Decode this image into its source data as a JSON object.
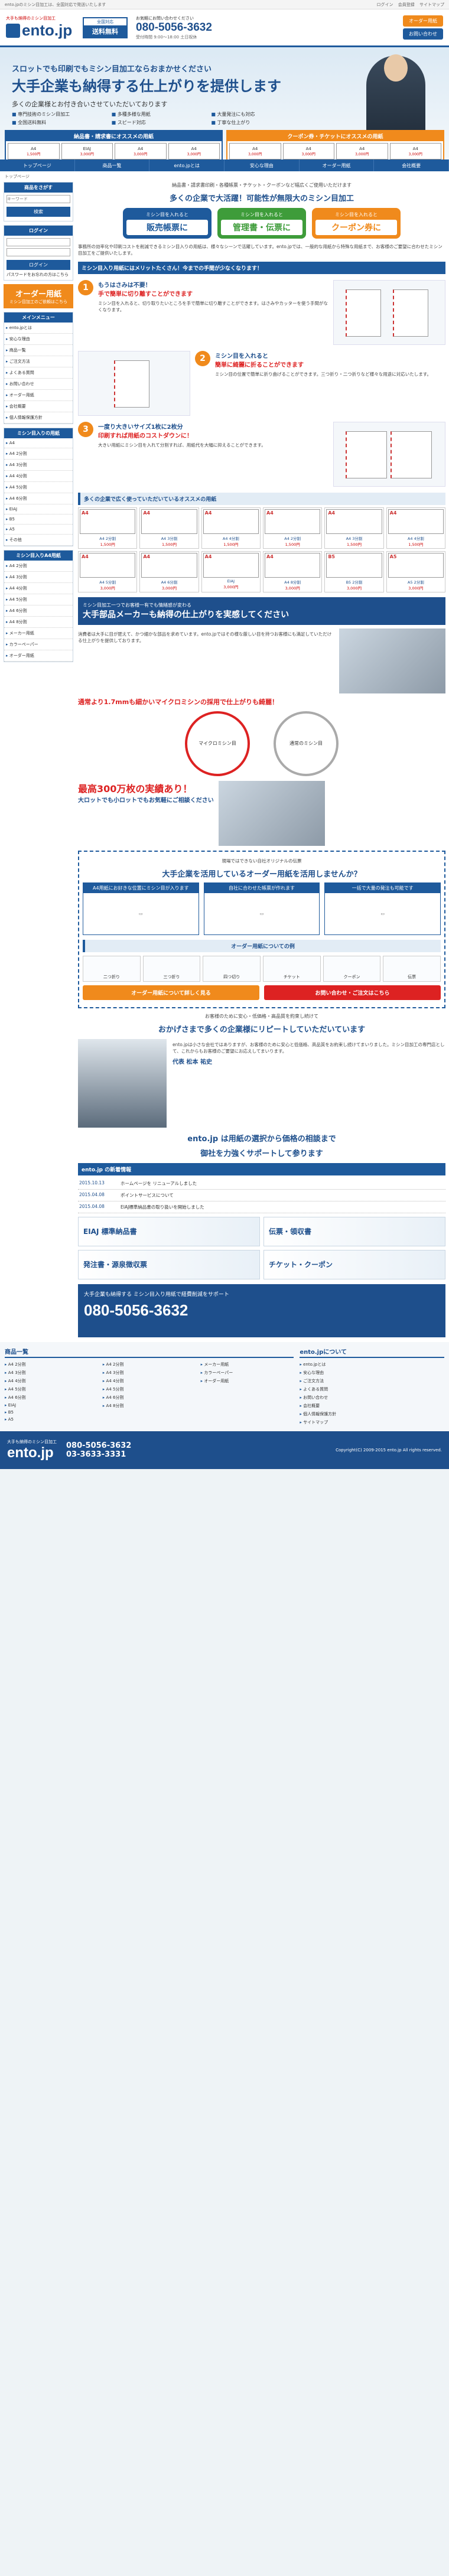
{
  "topbar": {
    "notice": "ento.jpのミシン目加工は、全国対応で発送いたします",
    "links": [
      "ログイン",
      "会員登録",
      "サイトマップ"
    ]
  },
  "header": {
    "tagline": "大手も納得のミシン目加工",
    "logo": "ento.jp",
    "ship_top": "全国対応",
    "ship_bottom": "送料無料",
    "contact_l1": "お気軽にお問い合わせください",
    "tel": "080-5056-3632",
    "contact_l2": "受付時間 9:00〜18:00 土日祝休",
    "btn_order": "オーダー用紙",
    "btn_contact": "お問い合わせ"
  },
  "hero": {
    "h1": "スロットでも印刷でもミシン目加工ならおまかせください",
    "h2": "大手企業も納得する仕上がりを提供します",
    "h3": "多くの企業様とお付き合いさせていただいております",
    "features": [
      "専門技術のミシン目加工",
      "多種多様な用紙",
      "大量発注にも対応",
      "全国送料無料",
      "スピード対応",
      "丁寧な仕上がり"
    ],
    "card1": "納品書・請求書にオススメの用紙",
    "card2": "クーポン券・チケットにオススメの用紙",
    "minis": [
      {
        "name": "A4",
        "price": "1,500円"
      },
      {
        "name": "EIAJ",
        "price": "3,000円"
      },
      {
        "name": "A4",
        "price": "3,000円"
      },
      {
        "name": "A4",
        "price": "3,000円"
      },
      {
        "name": "A4",
        "price": "3,000円"
      },
      {
        "name": "A4",
        "price": "3,000円"
      },
      {
        "name": "A4",
        "price": "3,000円"
      },
      {
        "name": "A4",
        "price": "3,000円"
      }
    ]
  },
  "nav": [
    "トップページ",
    "商品一覧",
    "ento.jpとは",
    "安心な理由",
    "オーダー用紙",
    "会社概要"
  ],
  "crumb": "トップページ",
  "side": {
    "search_title": "商品をさがす",
    "search_ph": "キーワード",
    "search_btn": "検索",
    "login_title": "ログイン",
    "login_btn": "ログイン",
    "login_note": "パスワードをお忘れの方はこちら",
    "order_t1": "オーダー用紙",
    "order_t2": "ミシン目加工のご依頼はこちら",
    "menu_title": "メインメニュー",
    "menu": [
      "ento.jpとは",
      "安心な理由",
      "商品一覧",
      "ご注文方法",
      "よくある質問",
      "お問い合わせ",
      "オーダー用紙",
      "会社概要",
      "個人情報保護方針"
    ],
    "cat_title": "ミシン目入りの用紙",
    "cats": [
      "A4",
      "A4 2分割",
      "A4 3分割",
      "A4 4分割",
      "A4 5分割",
      "A4 6分割",
      "EIAJ",
      "B5",
      "A5",
      "その他"
    ],
    "cat2_title": "ミシン目入りA4用紙",
    "cats2": [
      "A4 2分割",
      "A4 3分割",
      "A4 4分割",
      "A4 5分割",
      "A4 6分割",
      "A4 8分割",
      "メーカー用紙",
      "カラーペーパー",
      "オーダー用紙"
    ]
  },
  "main": {
    "lead": "納品書・請求書印刷・各種帳票・チケット・クーポンなど幅広くご使用いただけます",
    "title": "多くの企業で大活躍！可能性が無限大のミシン目加工",
    "bub": [
      {
        "t": "ミシン目を入れると",
        "b": "販売帳票に"
      },
      {
        "t": "ミシン目を入れると",
        "b": "管理書・伝票に"
      },
      {
        "t": "ミシン目を入れると",
        "b": "クーポン券に"
      }
    ],
    "intro": "事務所の効率化や印刷コストを削減できるミシン目入りの用紙は、様々なシーンで活躍しています。ento.jpでは、一般的な用紙から特殊な用紙まで、お客様のご要望に合わせたミシン目加工をご提供いたします。",
    "bar1": "ミシン目入り用紙にはメリットたくさん！今までの手間が少なくなります！",
    "points": [
      {
        "n": "1",
        "t": "もうはさみは不要！",
        "s": "手で簡単に切り離すことができます",
        "d": "ミシン目を入れると、切り取りたいところを手で簡単に切り離すことができます。はさみやカッターを使う手間がなくなります。"
      },
      {
        "n": "2",
        "t": "ミシン目を入れると",
        "s": "簡単に綺麗に折ることができます",
        "d": "ミシン目の位置で簡単に折り曲げることができます。三つ折り・二つ折りなど様々な用途に対応いたします。"
      },
      {
        "n": "3",
        "t": "一度り大きいサイズ1枚に2枚分",
        "s": "印刷すれば用紙のコストダウンに！",
        "d": "大きい用紙にミシン目を入れて分割すれば、用紙代を大幅に抑えることができます。"
      }
    ],
    "bar2": "多くの企業で広く使っていただいているオススメの用紙",
    "products": [
      {
        "l": "A4",
        "n": "A4 2分割",
        "p": "1,500円"
      },
      {
        "l": "A4",
        "n": "A4 3分割",
        "p": "1,500円"
      },
      {
        "l": "A4",
        "n": "A4 4分割",
        "p": "1,500円"
      },
      {
        "l": "A4",
        "n": "A4 2分割",
        "p": "1,500円"
      },
      {
        "l": "A4",
        "n": "A4 3分割",
        "p": "1,500円"
      },
      {
        "l": "A4",
        "n": "A4 4分割",
        "p": "1,500円"
      },
      {
        "l": "A4",
        "n": "A4 5分割",
        "p": "3,000円"
      },
      {
        "l": "A4",
        "n": "A4 6分割",
        "p": "3,000円"
      },
      {
        "l": "A4",
        "n": "EIAJ",
        "p": "3,000円"
      },
      {
        "l": "A4",
        "n": "A4 8分割",
        "p": "3,000円"
      },
      {
        "l": "B5",
        "n": "B5 2分割",
        "p": "3,000円"
      },
      {
        "l": "A5",
        "n": "A5 2分割",
        "p": "3,000円"
      }
    ],
    "maker1": "ミシン目加工一つでお客様一有でも情緒感が変わる",
    "maker2": "大手部品メーカーも納得の仕上がりを実感してください",
    "maker_p": "消費者は大手に目が肥えて、かつ細かな部品を求めています。ento.jpではその様な厳しい目を持つお客様にも満足していただける仕上がりを提供しております。",
    "hl1": "通常より1.7mmも細かいマイクロミシンの採用で仕上がりも綺麗！",
    "circ1": "マイクロミシン目",
    "circ2": "通常のミシン目",
    "big300": "最高300万枚の実績あり！",
    "big300_sub": "大ロットでも小ロットでもお気軽にご相談ください",
    "q1": "現場ではできない自社オリジナルの伝票",
    "q2": "大手企業を活用しているオーダー用紙を活用しませんか？",
    "flow": [
      "A4用紙にお好きな位置にミシン目が入ります",
      "自社に合わせた帳票が作れます",
      "一括で大量の発注も可能です"
    ],
    "flow_title": "オーダー用紙についての例",
    "tabs": [
      "二つ折り",
      "三つ折り",
      "四つ切り",
      "チケット",
      "クーポン",
      "伝票"
    ],
    "cta1": "オーダー用紙について詳しく見る",
    "cta2": "お問い合わせ・ご注文はこちら",
    "person_title": "お客様のために安心・低価格・高品質を約束し続けて",
    "person_title2": "おかげさまで多くの企業様にリピートしていただいています",
    "person_name": "代表 松本 祐史",
    "person_p": "ento.jpは小さな会社ではありますが、お客様のために安心と低価格、高品質をお約束し続けてまいりました。ミシン目加工の専門店として、これからもお客様のご要望にお応えしてまいります。",
    "ento_p1": "ento.jp は用紙の選択から価格の相談まで",
    "ento_p2": "御社を力強くサポートして参ります",
    "news_title": "ento.jp の新着情報",
    "news": [
      {
        "d": "2015.10.13",
        "t": "ホームページを リニューアルしました"
      },
      {
        "d": "2015.04.08",
        "t": "ポイントサービスについて"
      },
      {
        "d": "2015.04.08",
        "t": "EIAJ標準納品書の取り扱いを開始しました"
      }
    ],
    "promo": [
      "EIAJ 標準納品書",
      "伝票・領収書",
      "発注書・源泉徴収票",
      "チケット・クーポン"
    ],
    "big_cta_t1": "大手企業も納得する ミシン目入り用紙で経費削減をサポート",
    "big_cta_tel": "080-5056-3632"
  },
  "fnav": {
    "h1": "商品一覧",
    "h2": "ento.jpについて",
    "c1": [
      "A4 2分割",
      "A4 3分割",
      "A4 4分割",
      "A4 5分割",
      "A4 6分割",
      "EIAJ",
      "B5",
      "A5"
    ],
    "c2": [
      "A4 2分割",
      "A4 3分割",
      "A4 4分割",
      "A4 5分割",
      "A4 6分割",
      "A4 8分割"
    ],
    "c3": [
      "メーカー用紙",
      "カラーペーパー",
      "オーダー用紙"
    ],
    "c4": [
      "ento.jpとは",
      "安心な理由",
      "ご注文方法",
      "よくある質問",
      "お問い合わせ",
      "会社概要",
      "個人情報保護方針",
      "サイトマップ"
    ]
  },
  "footer": {
    "tag": "大手も納得のミシン目加工",
    "logo": "ento.jp",
    "tel1": "080-5056-3632",
    "tel2": "03-3633-3331",
    "copy": "Copyright(C) 2009-2015 ento.jp All rights reserved."
  }
}
